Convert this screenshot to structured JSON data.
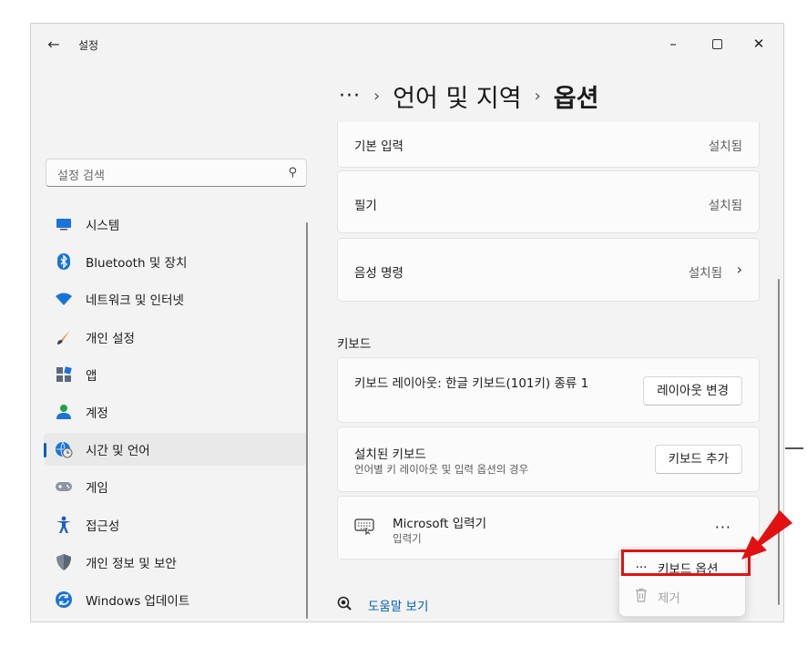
{
  "window": {
    "title": "설정"
  },
  "sidebar": {
    "search_placeholder": "설정 검색",
    "items": [
      {
        "label": "시스템",
        "icon": "monitor-icon"
      },
      {
        "label": "Bluetooth 및 장치",
        "icon": "bluetooth-icon"
      },
      {
        "label": "네트워크 및 인터넷",
        "icon": "wifi-icon"
      },
      {
        "label": "개인 설정",
        "icon": "brush-icon"
      },
      {
        "label": "앱",
        "icon": "apps-icon"
      },
      {
        "label": "계정",
        "icon": "account-icon"
      },
      {
        "label": "시간 및 언어",
        "icon": "globe-clock-icon",
        "selected": true
      },
      {
        "label": "게임",
        "icon": "gamepad-icon"
      },
      {
        "label": "접근성",
        "icon": "accessibility-icon"
      },
      {
        "label": "개인 정보 및 보안",
        "icon": "shield-icon"
      },
      {
        "label": "Windows 업데이트",
        "icon": "update-icon"
      }
    ]
  },
  "header": {
    "ellipsis": "···",
    "crumbs": [
      "언어 및 지역",
      "옵션"
    ]
  },
  "features": [
    {
      "label": "기본 입력",
      "status": "설치됨"
    },
    {
      "label": "필기",
      "status": "설치됨"
    },
    {
      "label": "음성 명령",
      "status": "설치됨",
      "chevron": "›"
    }
  ],
  "keyboard": {
    "section_title": "키보드",
    "layout": {
      "label": "키보드 레이아웃: 한글 키보드(101키) 종류 1",
      "button": "레이아웃 변경"
    },
    "installed": {
      "label": "설치된 키보드",
      "desc": "언어별 키 레이아웃 및 입력 옵션의 경우",
      "button": "키보드 추가"
    },
    "ime": {
      "name": "Microsoft 입력기",
      "sub": "입력기",
      "more": "···"
    }
  },
  "context_menu": {
    "items": [
      {
        "label": "키보드 옵션",
        "icon": "···"
      },
      {
        "label": "제거",
        "icon": "trash-icon",
        "disabled": true
      }
    ]
  },
  "help": {
    "label": "도움말 보기"
  },
  "colors": {
    "accent": "#005fb8",
    "highlight": "#e11111",
    "window_bg": "#f3f3f3",
    "card_bg": "#fbfbfb"
  }
}
